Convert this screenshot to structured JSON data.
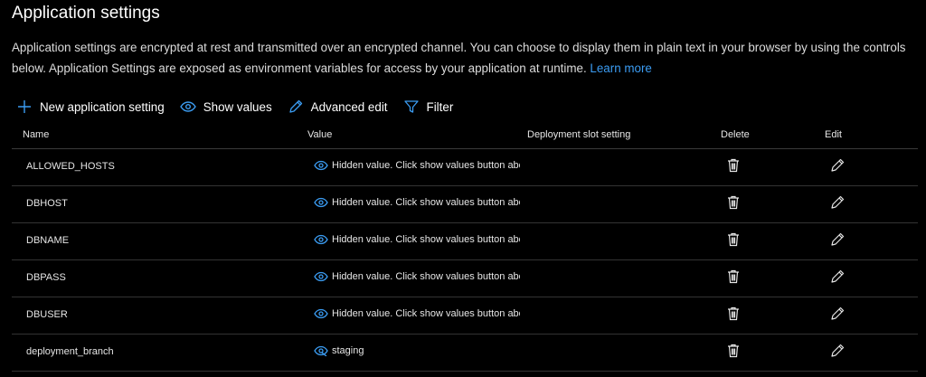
{
  "section": {
    "title": "Application settings",
    "description": "Application settings are encrypted at rest and transmitted over an encrypted channel. You can choose to display them in plain text in your browser by using the controls below. Application Settings are exposed as environment variables for access by your application at runtime.",
    "learn_more": "Learn more"
  },
  "toolbar": {
    "new_setting": "New application setting",
    "show_values": "Show values",
    "advanced_edit": "Advanced edit",
    "filter": "Filter"
  },
  "table": {
    "headers": {
      "name": "Name",
      "value": "Value",
      "slot": "Deployment slot setting",
      "delete": "Delete",
      "edit": "Edit"
    },
    "rows": [
      {
        "name": "ALLOWED_HOSTS",
        "value": "Hidden value. Click show values button above to view",
        "hidden": true
      },
      {
        "name": "DBHOST",
        "value": "Hidden value. Click show values button above to view",
        "hidden": true
      },
      {
        "name": "DBNAME",
        "value": "Hidden value. Click show values button above to view",
        "hidden": true
      },
      {
        "name": "DBPASS",
        "value": "Hidden value. Click show values button above to view",
        "hidden": true
      },
      {
        "name": "DBUSER",
        "value": "Hidden value. Click show values button above to view",
        "hidden": true
      },
      {
        "name": "deployment_branch",
        "value": "staging",
        "hidden": false
      }
    ]
  },
  "colors": {
    "accent": "#3b9cf2",
    "background": "#000000",
    "text": "#e6e6e6"
  },
  "icons": {
    "new": "plus-icon",
    "show": "eye-icon",
    "advanced": "pencil-icon",
    "filter": "filter-icon",
    "hidden_value": "eye-icon",
    "visible_value": "eye-slash-icon",
    "delete": "trash-icon",
    "edit": "pencil-icon"
  }
}
